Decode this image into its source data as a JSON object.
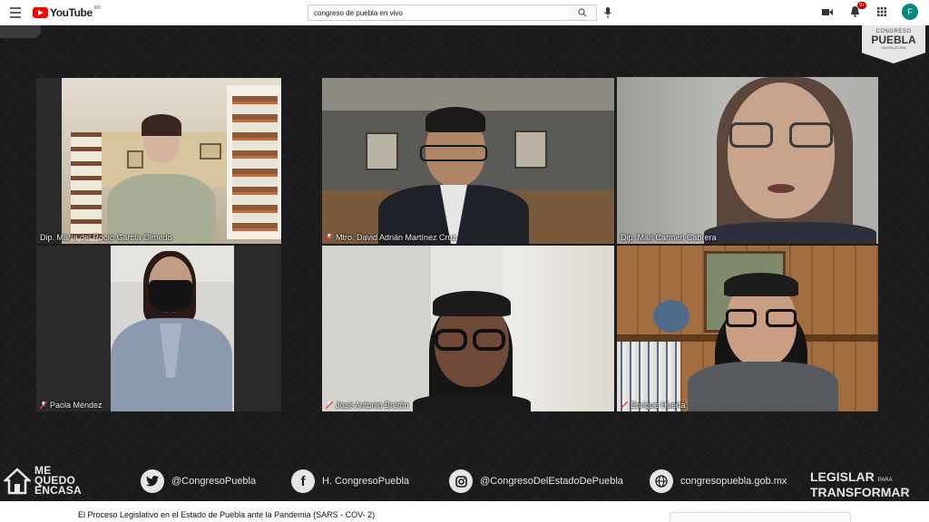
{
  "header": {
    "logo_text": "YouTube",
    "region": "MX",
    "search_value": "congreso de puebla en vivo",
    "notification_count": "9+",
    "avatar_letter": "F"
  },
  "video": {
    "badge": {
      "top": "CONGRESO",
      "name": "PUEBLA",
      "sub": "LEGISLATURA"
    },
    "participants": [
      {
        "label": "Dip. María del Rocío García Olmedo",
        "muted": false
      },
      {
        "label": "Mtro. David Adrián Martínez Cruz",
        "muted": true
      },
      {
        "label": "Dip. Mari Carmen Cabrera",
        "muted": false,
        "active": true
      },
      {
        "label": "Paola Méndez",
        "muted": true
      },
      {
        "label": "José Antonio Bretón",
        "muted": true
      },
      {
        "label": "Enrique Huerta",
        "muted": true
      }
    ],
    "footer": {
      "me_quedo": [
        "ME",
        "QUEDO",
        "ENCASA"
      ],
      "twitter": "@CongresoPuebla",
      "facebook": "H. CongresoPuebla",
      "instagram": "@CongresoDelEstadoDePuebla",
      "website": "congresopuebla.gob.mx",
      "legislar": "LEGISLAR",
      "para": "PARA",
      "transformar": "TRANSFORMAR"
    }
  },
  "title": "El Proceso Legislativo en el Estado de Puebla ante la Pandemia (SARS - COV- 2)",
  "colors": {
    "active_speaker_border": "#c9e86a",
    "youtube_red": "#ff0000",
    "avatar": "#00897b"
  }
}
